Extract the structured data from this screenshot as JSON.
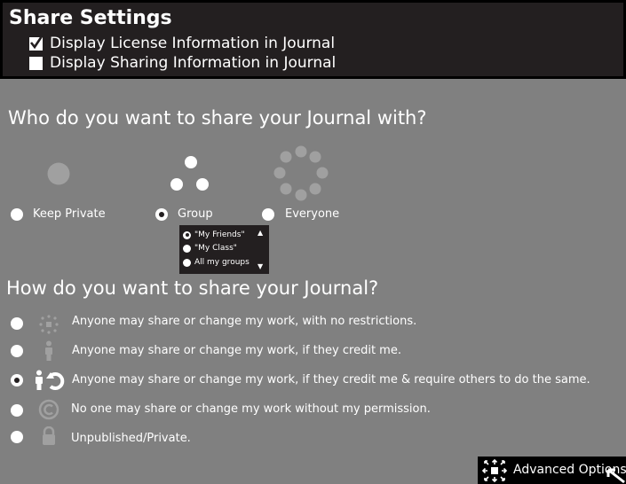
{
  "header": {
    "title": "Share Settings",
    "checkboxes": [
      {
        "label": "Display License Information in Journal",
        "checked": true
      },
      {
        "label": "Display Sharing Information in Journal",
        "checked": false
      }
    ]
  },
  "share_with": {
    "question": "Who do you want to share your Journal with?",
    "options": [
      {
        "label": "Keep Private",
        "icon": "single-circle-icon",
        "selected": false
      },
      {
        "label": "Group",
        "icon": "group-circles-icon",
        "selected": true
      },
      {
        "label": "Everyone",
        "icon": "everyone-ring-icon",
        "selected": false
      }
    ],
    "group_list": [
      {
        "label": "\"My Friends\"",
        "selected": true
      },
      {
        "label": "\"My Class\"",
        "selected": false
      },
      {
        "label": "All my groups",
        "selected": false
      }
    ]
  },
  "license": {
    "question": "How do you want to share your Journal?",
    "options": [
      {
        "label": "Anyone may share or change my work, with no restrictions.",
        "icon": "public-domain-icon",
        "selected": false
      },
      {
        "label": "Anyone may share or change my work, if they credit me.",
        "icon": "attribution-icon",
        "selected": false
      },
      {
        "label": "Anyone may share or change my work, if they credit me & require others to do the same.",
        "icon": "attribution-sharealike-icon",
        "selected": true
      },
      {
        "label": "No one may share or change my work without my permission.",
        "icon": "copyright-icon",
        "selected": false
      },
      {
        "label": "Unpublished/Private.",
        "icon": "lock-icon",
        "selected": false
      }
    ]
  },
  "footer": {
    "advanced_label": "Advanced Options"
  },
  "colors": {
    "background": "#808080",
    "header_bg": "#231f20",
    "icon_gray": "#a0a0a0"
  }
}
